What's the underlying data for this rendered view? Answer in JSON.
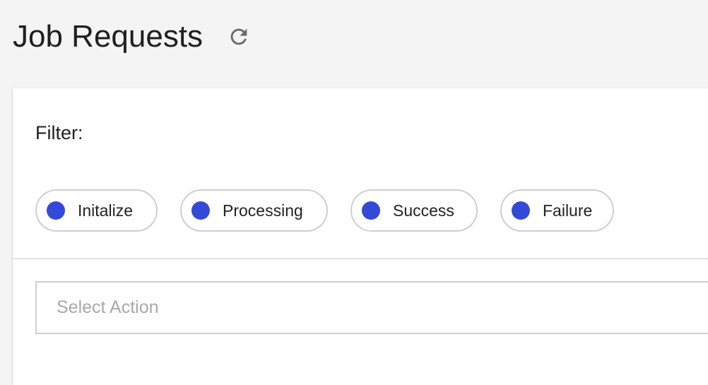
{
  "header": {
    "title": "Job Requests",
    "refresh_icon": "refresh-icon"
  },
  "filter": {
    "label": "Filter:",
    "chips": [
      {
        "label": "Initalize",
        "color": "#3549d8"
      },
      {
        "label": "Processing",
        "color": "#3549d8"
      },
      {
        "label": "Success",
        "color": "#3549d8"
      },
      {
        "label": "Failure",
        "color": "#3549d8"
      }
    ]
  },
  "action_select": {
    "placeholder": "Select Action"
  },
  "colors": {
    "accent": "#3549d8",
    "background": "#f4f4f4",
    "card": "#ffffff",
    "border": "#cfcfcf"
  }
}
